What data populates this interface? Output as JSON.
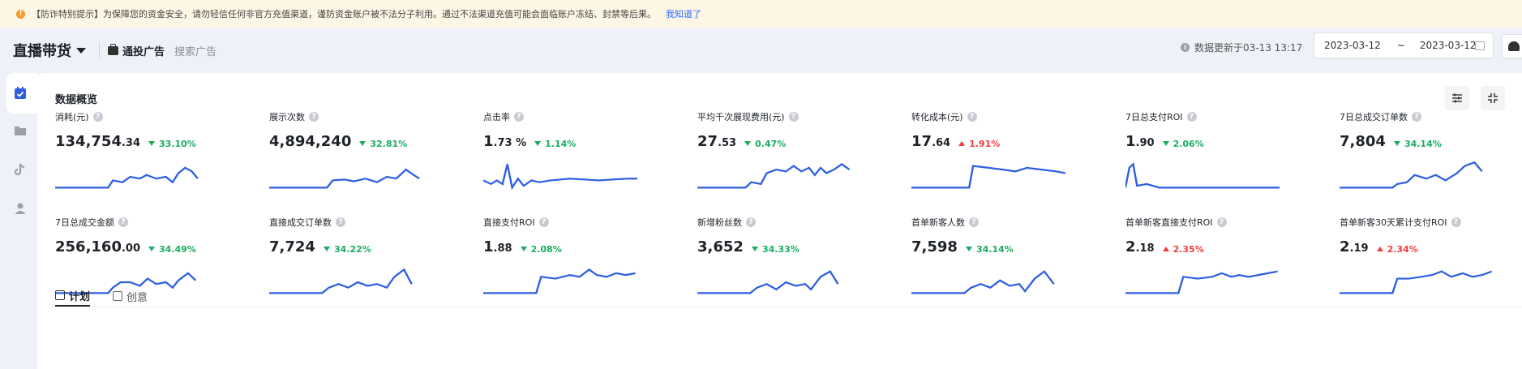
{
  "notice": {
    "icon": "warning-icon",
    "text": "【防诈特别提示】为保障您的资金安全，请勿轻信任何非官方充值渠道，谨防资金账户被不法分子利用。通过不法渠道充值可能会面临账户冻结、封禁等后果。",
    "link": "我知道了"
  },
  "header": {
    "brand": "直播带货",
    "tabs": [
      {
        "label": "通投广告",
        "active": true,
        "icon": "briefcase-icon"
      },
      {
        "label": "搜索广告",
        "active": false
      }
    ],
    "update_text": "数据更新于03-13 13:17",
    "date_start": "2023-03-12",
    "date_sep": "~",
    "date_end": "2023-03-12"
  },
  "sidebar": {
    "items": [
      {
        "icon": "calendar-check-icon",
        "active": true
      },
      {
        "icon": "folder-icon",
        "active": false
      },
      {
        "icon": "tiktok-icon",
        "active": false
      },
      {
        "icon": "user-icon",
        "active": false
      }
    ]
  },
  "overview": {
    "title": "数据概览",
    "metrics": [
      {
        "label": "消耗(元)",
        "int": "134,754",
        "dec": ".34",
        "change": "33.10%",
        "dir": "down"
      },
      {
        "label": "展示次数",
        "int": "4,894,240",
        "dec": "",
        "change": "32.81%",
        "dir": "down"
      },
      {
        "label": "点击率",
        "int": "1",
        "dec": ".73 %",
        "change": "1.14%",
        "dir": "down"
      },
      {
        "label": "平均千次展现费用(元)",
        "int": "27",
        "dec": ".53",
        "change": "0.47%",
        "dir": "down"
      },
      {
        "label": "转化成本(元)",
        "int": "17",
        "dec": ".64",
        "change": "1.91%",
        "dir": "up"
      },
      {
        "label": "7日总支付ROI",
        "int": "1",
        "dec": ".90",
        "change": "2.06%",
        "dir": "down"
      },
      {
        "label": "7日总成交订单数",
        "int": "7,804",
        "dec": "",
        "change": "34.14%",
        "dir": "down"
      },
      {
        "label": "7日总成交金额",
        "int": "256,160",
        "dec": ".00",
        "change": "34.49%",
        "dir": "down"
      },
      {
        "label": "直接成交订单数",
        "int": "7,724",
        "dec": "",
        "change": "34.22%",
        "dir": "down"
      },
      {
        "label": "直接支付ROI",
        "int": "1",
        "dec": ".88",
        "change": "2.08%",
        "dir": "down"
      },
      {
        "label": "新增粉丝数",
        "int": "3,652",
        "dec": "",
        "change": "34.33%",
        "dir": "down"
      },
      {
        "label": "首单新客人数",
        "int": "7,598",
        "dec": "",
        "change": "34.14%",
        "dir": "down"
      },
      {
        "label": "首单新客直接支付ROI",
        "int": "2",
        "dec": ".18",
        "change": "2.35%",
        "dir": "up"
      },
      {
        "label": "首单新客30天累计支付ROI",
        "int": "2",
        "dec": ".19",
        "change": "2.34%",
        "dir": "up"
      }
    ]
  },
  "bottom_tabs": [
    {
      "label": "计划",
      "active": true,
      "icon": "plan-icon"
    },
    {
      "label": "创意",
      "active": false,
      "icon": "creative-icon"
    }
  ],
  "colors": {
    "accent": "#2f5fe0",
    "down": "#1aad5f",
    "up": "#f03e3e"
  }
}
